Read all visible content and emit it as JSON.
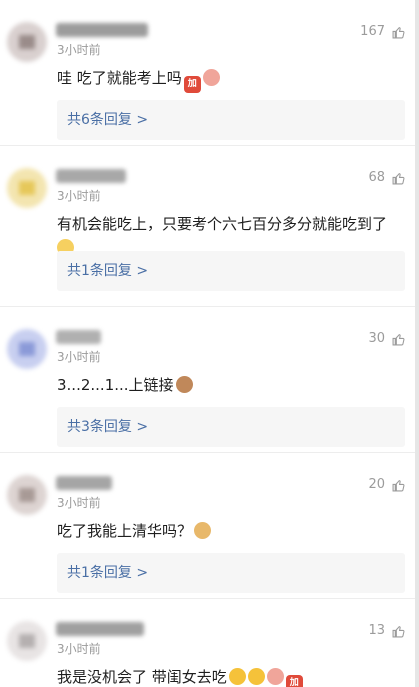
{
  "comments": [
    {
      "time": "3小时前",
      "likes": "167",
      "text": "哇 吃了就能考上吗",
      "emojis": [
        "jia",
        "pig"
      ],
      "replies": "共6条回复 >",
      "avatar_colors": [
        "#9a8c8a",
        "#d9d0cf"
      ]
    },
    {
      "time": "3小时前",
      "likes": "68",
      "text_line1": "有机会能吃上，只要考个六七百分多分就能吃到了",
      "emojis": [
        "face"
      ],
      "replies": "共1条回复 >",
      "avatar_colors": [
        "#e6c85a",
        "#f3e5b0"
      ]
    },
    {
      "time": "3小时前",
      "likes": "30",
      "text": "3...2...1...上链接",
      "emojis": [
        "bear"
      ],
      "replies": "共3条回复 >",
      "avatar_colors": [
        "#8b9ad8",
        "#c8cff0"
      ]
    },
    {
      "time": "3小时前",
      "likes": "20",
      "text": "吃了我能上清华吗？",
      "emojis": [
        "dog"
      ],
      "replies": "共1条回复 >",
      "avatar_colors": [
        "#a89a96",
        "#ddd4d2"
      ]
    },
    {
      "time": "3小时前",
      "likes": "13",
      "text": "我是没机会了 带闺女去吃",
      "emojis": [
        "laugh",
        "laugh",
        "pig",
        "jia"
      ],
      "avatar_colors": [
        "#b5b0b0",
        "#e8e4e4"
      ]
    }
  ],
  "emoji_glyphs": {
    "jia": "加",
    "pig": "",
    "face": "",
    "bear": "",
    "dog": "",
    "laugh": ""
  }
}
